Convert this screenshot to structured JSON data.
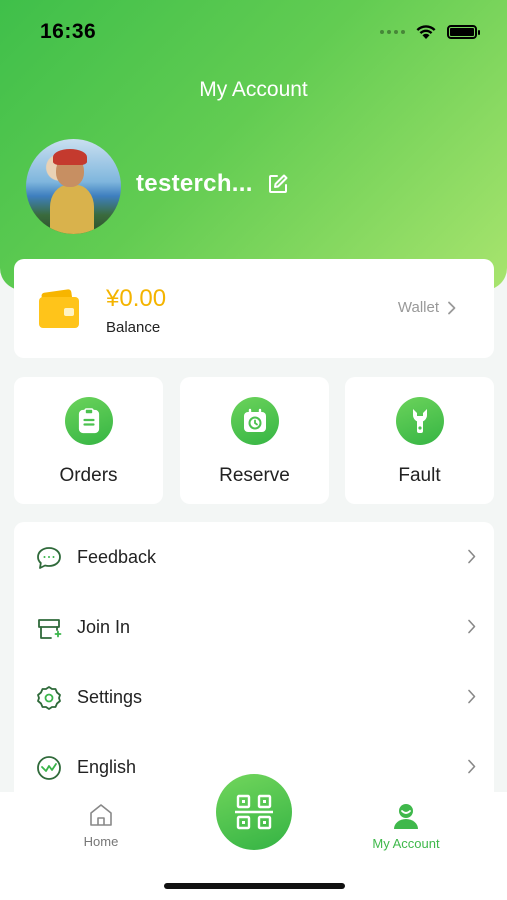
{
  "status_bar": {
    "time": "16:36"
  },
  "header": {
    "title": "My Account",
    "username": "testerch..."
  },
  "wallet": {
    "balance_amount": "¥0.00",
    "balance_label": "Balance",
    "link_label": "Wallet"
  },
  "quick_actions": [
    {
      "label": "Orders",
      "icon": "clipboard-icon"
    },
    {
      "label": "Reserve",
      "icon": "calendar-clock-icon"
    },
    {
      "label": "Fault",
      "icon": "wrench-icon"
    }
  ],
  "menu": [
    {
      "label": "Feedback",
      "icon": "chat-bubble-icon"
    },
    {
      "label": "Join In",
      "icon": "store-plus-icon"
    },
    {
      "label": "Settings",
      "icon": "gear-icon"
    },
    {
      "label": "English",
      "icon": "language-icon"
    }
  ],
  "tabbar": {
    "home_label": "Home",
    "account_label": "My Account",
    "active_tab": "My Account",
    "scan_icon": "qr-scan-icon"
  },
  "colors": {
    "accent": "#3fb84b",
    "balance": "#f4b400",
    "header_start": "#3fbf4a",
    "header_end": "#a8e46e"
  }
}
